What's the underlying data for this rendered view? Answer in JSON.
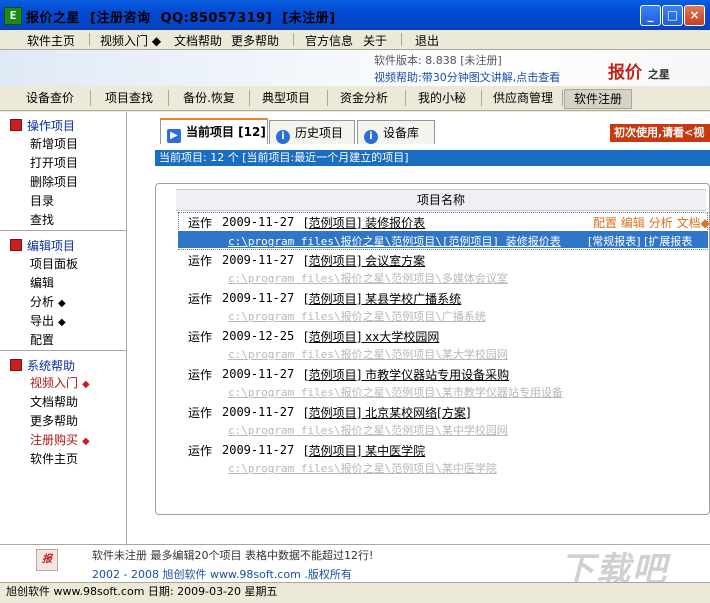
{
  "window": {
    "title": "报价之星  [注册咨询  QQ:85057319]  [未注册]",
    "app_icon": "E",
    "btn_minimize": "_",
    "btn_maximize": "□",
    "btn_close": "×"
  },
  "menu": [
    {
      "label": "软件主页"
    },
    {
      "label": "视频入门 ◆"
    },
    {
      "label": "文档帮助"
    },
    {
      "label": "更多帮助"
    },
    {
      "label": "官方信息"
    },
    {
      "label": "关于"
    },
    {
      "label": "退出"
    }
  ],
  "banner": {
    "version": "软件版本: 8.838  [未注册]",
    "video_help": "视频帮助:带30分钟图文讲解,点击查看",
    "logo_main": "报价",
    "logo_small": "之星"
  },
  "toolbar": [
    {
      "label": "设备查价"
    },
    {
      "label": "项目查找"
    },
    {
      "label": "备份.恢复"
    },
    {
      "label": "典型项目"
    },
    {
      "label": "资金分析"
    },
    {
      "label": "我的小秘"
    },
    {
      "label": "供应商管理"
    },
    {
      "label": "软件注册"
    }
  ],
  "sidebar": {
    "sections": [
      {
        "title": "操作项目",
        "items": [
          "新增项目",
          "打开项目",
          "删除项目",
          "目录",
          "查找"
        ]
      },
      {
        "title": "编辑项目",
        "items": [
          "项目面板",
          "编辑",
          "分析",
          "导出",
          "配置"
        ]
      },
      {
        "title": "系统帮助",
        "items": [
          "视频入门",
          "文档帮助",
          "更多帮助",
          "注册购买",
          "软件主页"
        ]
      }
    ],
    "diamond": "◆"
  },
  "tabs": {
    "current": "当前项目 [12]",
    "history": "历史项目",
    "library": "设备库",
    "info_icon": "i"
  },
  "first_use": "初次使用,请看<视",
  "current_bar": "当前项目: 12 个    [当前项目:最近一个月建立的项目]",
  "list": {
    "header": "项目名称",
    "actions": "配置 编辑 分析 文档◆",
    "report_links": "[常规报表] [扩展报表",
    "rows": [
      {
        "op": "运作",
        "date": "2009-11-27",
        "name": "[范例项目] 装修报价表",
        "path": "c:\\program files\\报价之星\\范例项目\\[范例项目] 装修报价表"
      },
      {
        "op": "运作",
        "date": "2009-11-27",
        "name": "[范例项目] 会议室方案",
        "path": "c:\\program files\\报价之星\\范例项目\\多媒体会议室"
      },
      {
        "op": "运作",
        "date": "2009-11-27",
        "name": "[范例项目] 某县学校广播系统",
        "path": "c:\\program files\\报价之星\\范例项目\\广播系统"
      },
      {
        "op": "运作",
        "date": "2009-12-25",
        "name": "[范例项目] xx大学校园网",
        "path": "c:\\program files\\报价之星\\范例项目\\某大学校园网"
      },
      {
        "op": "运作",
        "date": "2009-11-27",
        "name": "[范例项目] 市教学仪器站专用设备采购",
        "path": "c:\\program files\\报价之星\\范例项目\\某市教学仪器站专用设备"
      },
      {
        "op": "运作",
        "date": "2009-11-27",
        "name": "[范例项目] 北京某校网络[方案]",
        "path": "c:\\program files\\报价之星\\范例项目\\某中学校园网"
      },
      {
        "op": "运作",
        "date": "2009-11-27",
        "name": "[范例项目] 某中医学院",
        "path": "c:\\program files\\报价之星\\范例项目\\某中医学院"
      }
    ]
  },
  "bottom": {
    "logo": "报",
    "message": "软件未注册 最多编辑20个项目 表格中数据不能超过12行!",
    "copyright": "2002 - 2008  旭创软件 www.98soft.com .版权所有",
    "watermark": "下载吧"
  },
  "status": "旭创软件 www.98soft.com 日期: 2009-03-20  星期五"
}
